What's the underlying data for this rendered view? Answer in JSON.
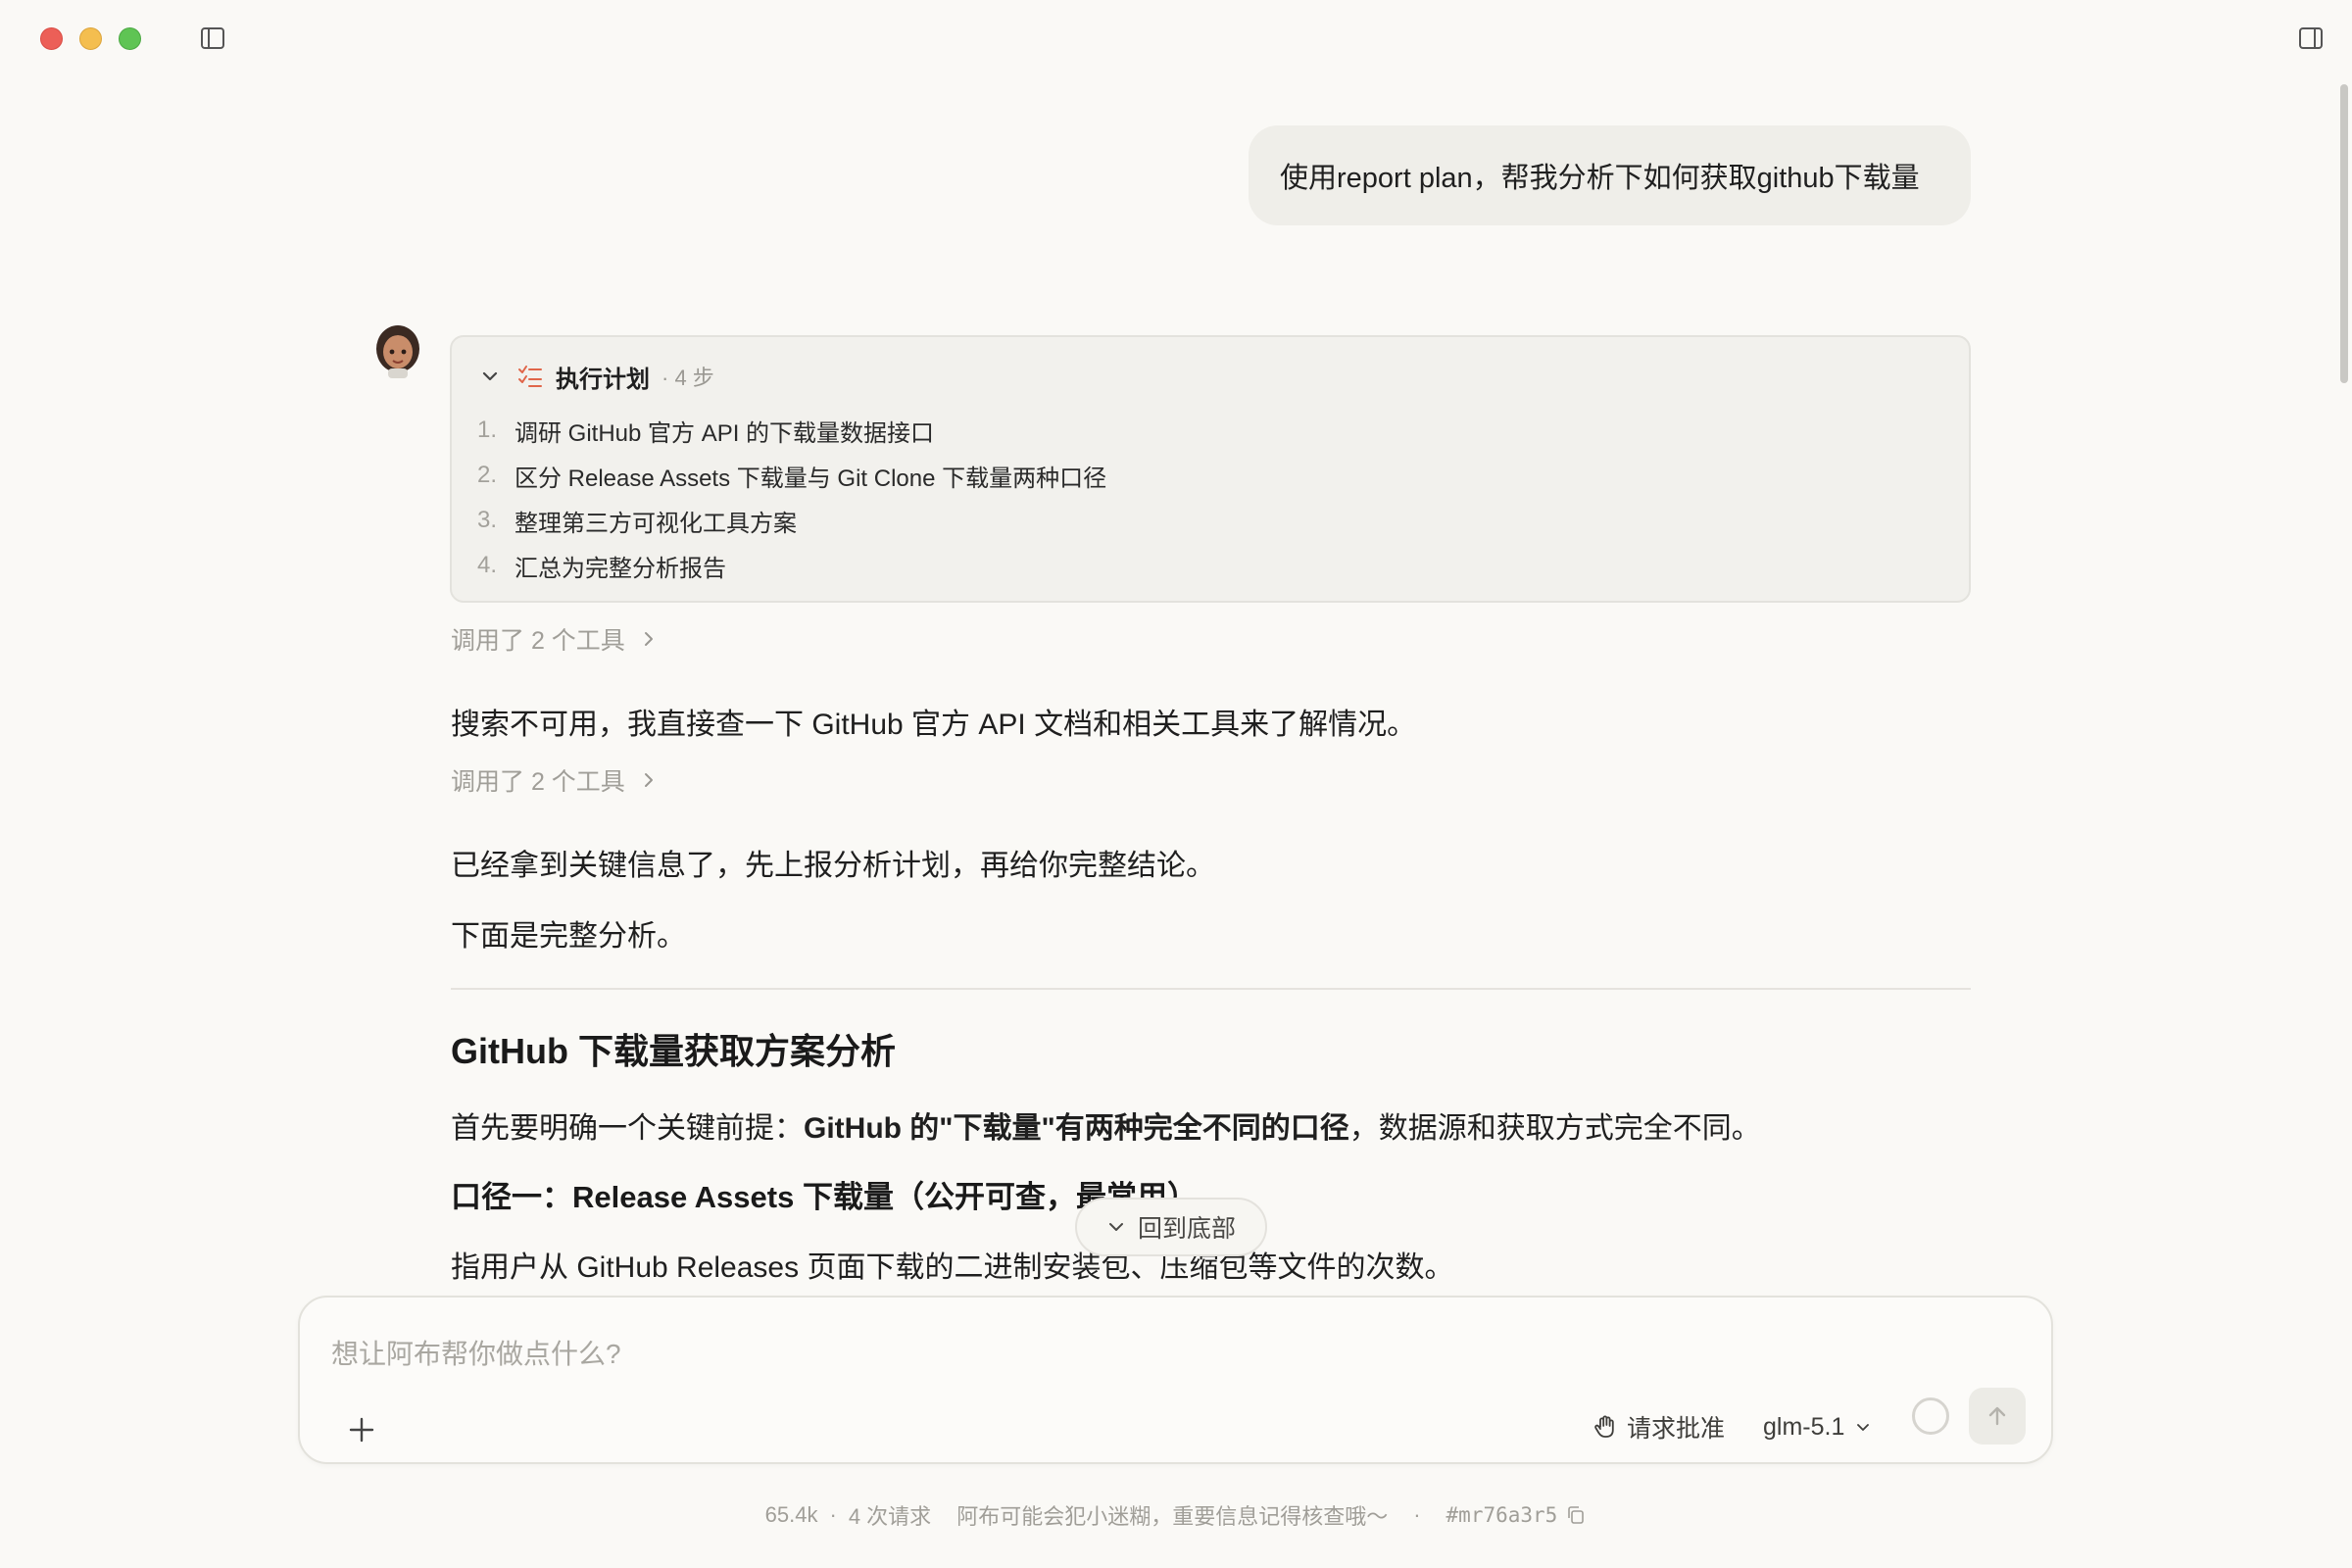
{
  "user_message": "使用report plan，帮我分析下如何获取github下载量",
  "plan": {
    "title": "执行计划",
    "steps_label": "· 4 步",
    "items": [
      {
        "num": "1.",
        "text": "调研 GitHub 官方 API 的下载量数据接口"
      },
      {
        "num": "2.",
        "text": "区分 Release Assets 下载量与 Git Clone 下载量两种口径"
      },
      {
        "num": "3.",
        "text": "整理第三方可视化工具方案"
      },
      {
        "num": "4.",
        "text": "汇总为完整分析报告"
      }
    ]
  },
  "tool_call_1": "调用了 2 个工具",
  "para_1": "搜索不可用，我直接查一下 GitHub 官方 API 文档和相关工具来了解情况。",
  "tool_call_2": "调用了 2 个工具",
  "para_2": "已经拿到关键信息了，先上报分析计划，再给你完整结论。",
  "para_3": "下面是完整分析。",
  "heading": "GitHub 下载量获取方案分析",
  "intro": {
    "prefix": "首先要明确一个关键前提：",
    "bold": "GitHub 的\"下载量\"有两种完全不同的口径",
    "suffix": "，数据源和获取方式完全不同。"
  },
  "subheading": "口径一：Release Assets 下载量（公开可查，最常用）",
  "para_4": "指用户从 GitHub Releases 页面下载的二进制安装包、压缩包等文件的次数。",
  "jump_bottom": "回到底部",
  "input": {
    "placeholder": "想让阿布帮你做点什么?",
    "approve_label": "请求批准",
    "model": "glm-5.1"
  },
  "footer": {
    "tokens": "65.4k",
    "requests": "4 次请求",
    "disclaimer": "阿布可能会犯小迷糊，重要信息记得核查哦～",
    "session_id": "#mr76a3r5"
  },
  "colors": {
    "background": "#faf9f6",
    "plan_icon": "#e0664a",
    "traffic_close": "#ec5f57",
    "traffic_min": "#f4be4f",
    "traffic_max": "#5fc454"
  }
}
